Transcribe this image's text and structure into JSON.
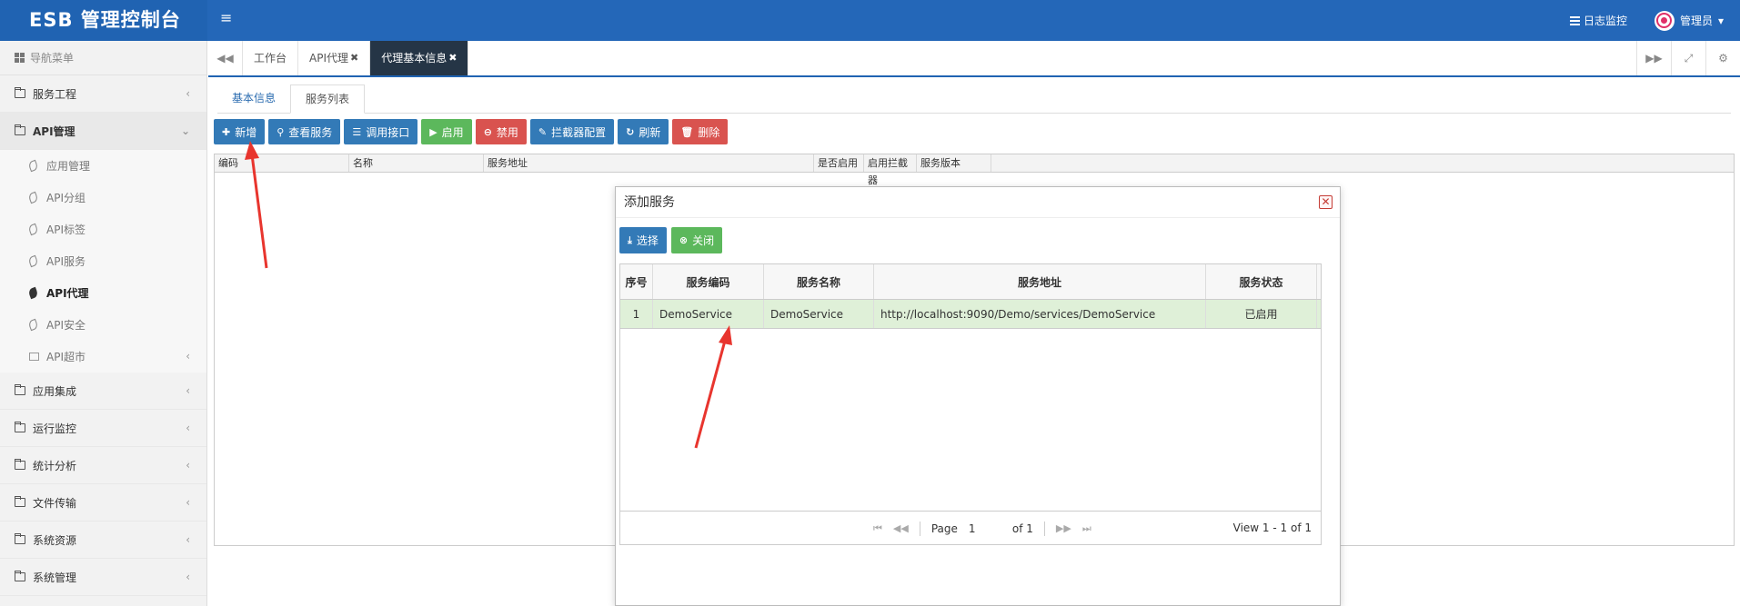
{
  "header": {
    "title": "ESB 管理控制台",
    "menu_toggle": "≡",
    "log_monitor": "日志监控",
    "user_name": "管理员",
    "user_caret": "▾"
  },
  "sidebar": {
    "heading": "导航菜单",
    "items": [
      {
        "label": "服务工程"
      },
      {
        "label": "API管理"
      },
      {
        "label": "应用集成"
      },
      {
        "label": "运行监控"
      },
      {
        "label": "统计分析"
      },
      {
        "label": "文件传输"
      },
      {
        "label": "系统资源"
      },
      {
        "label": "系统管理"
      }
    ],
    "sub_items": [
      {
        "label": "应用管理"
      },
      {
        "label": "API分组"
      },
      {
        "label": "API标签"
      },
      {
        "label": "API服务"
      },
      {
        "label": "API代理"
      },
      {
        "label": "API安全"
      },
      {
        "label": "API超市"
      }
    ]
  },
  "tabs": [
    {
      "label": "工作台"
    },
    {
      "label": "API代理"
    },
    {
      "label": "代理基本信息"
    }
  ],
  "subtabs": [
    "基本信息",
    "服务列表"
  ],
  "toolbar": {
    "add": "新增",
    "view": "查看服务",
    "call": "调用接口",
    "enable": "启用",
    "disable": "禁用",
    "interceptor": "拦截器配置",
    "refresh": "刷新",
    "delete": "删除"
  },
  "grid": {
    "columns": [
      "编码",
      "名称",
      "服务地址",
      "是否启用",
      "启用拦截器",
      "服务版本"
    ]
  },
  "modal": {
    "title": "添加服务",
    "select": "选择",
    "close": "关闭",
    "columns": [
      "序号",
      "服务编码",
      "服务名称",
      "服务地址",
      "服务状态"
    ],
    "rows": [
      {
        "index": "1",
        "code": "DemoService",
        "name": "DemoService",
        "url": "http://localhost:9090/Demo/services/DemoService",
        "status": "已启用"
      }
    ],
    "pager": {
      "page_label": "Page",
      "page_value": "1",
      "of": "of 1",
      "view": "View 1 - 1 of 1"
    }
  },
  "colors": {
    "header": "#2467b8",
    "primary": "#337ab7",
    "success": "#5cb85c",
    "danger": "#d9534f",
    "selected_row": "#dff0d8",
    "active_tab": "#253546",
    "arrow": "#e8352e"
  }
}
